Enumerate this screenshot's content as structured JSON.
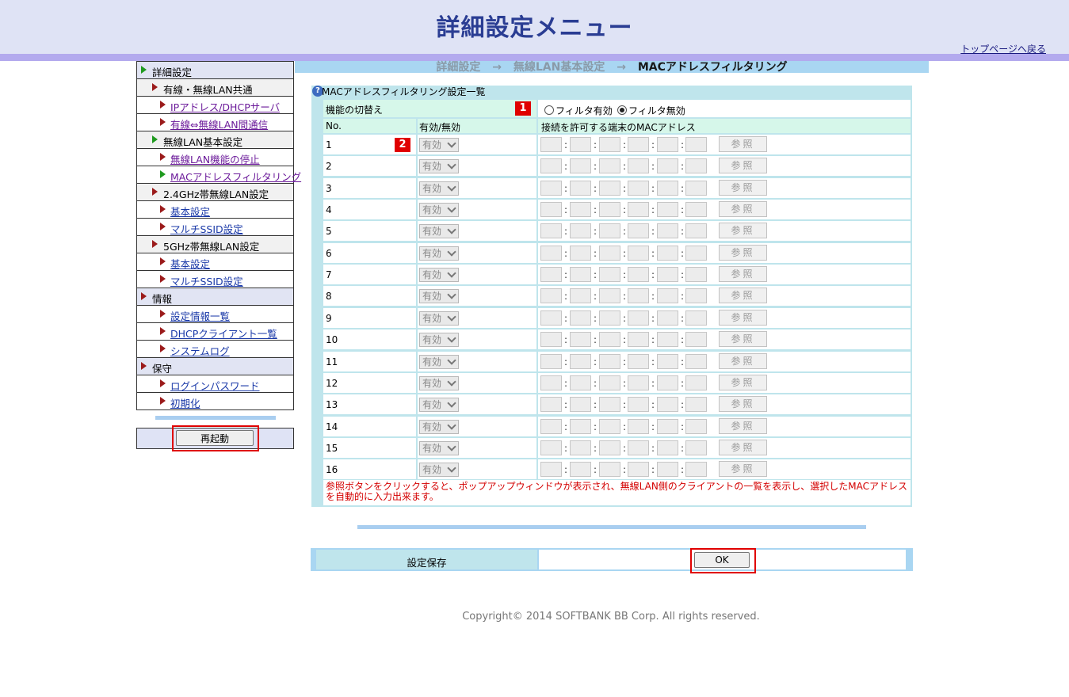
{
  "header": {
    "title": "詳細設定メニュー",
    "top_link": "トップページへ戻る"
  },
  "breadcrumb": {
    "items": [
      "詳細設定",
      "無線LAN基本設定",
      "MACアドレスフィルタリング"
    ],
    "separator": "→"
  },
  "sidebar": {
    "items": [
      {
        "label": "詳細設定",
        "kind": "section",
        "icon": "green-triangle-icon"
      },
      {
        "label": "有線・無線LAN共通",
        "kind": "sub",
        "icon": "red-triangle-icon"
      },
      {
        "label": "IPアドレス/DHCPサーバ",
        "kind": "link",
        "icon": "red-triangle-icon"
      },
      {
        "label": "有線⇔無線LAN間通信",
        "kind": "link",
        "icon": "red-triangle-icon"
      },
      {
        "label": "無線LAN基本設定",
        "kind": "sub",
        "icon": "green-triangle-icon"
      },
      {
        "label": "無線LAN機能の停止",
        "kind": "link",
        "icon": "red-triangle-icon"
      },
      {
        "label": "MACアドレスフィルタリング",
        "kind": "link",
        "icon": "green-triangle-icon"
      },
      {
        "label": "2.4GHz帯無線LAN設定",
        "kind": "sub",
        "icon": "red-triangle-icon"
      },
      {
        "label": "基本設定",
        "kind": "link-blue",
        "icon": "red-triangle-icon"
      },
      {
        "label": "マルチSSID設定",
        "kind": "link-blue",
        "icon": "red-triangle-icon"
      },
      {
        "label": "5GHz帯無線LAN設定",
        "kind": "sub",
        "icon": "red-triangle-icon"
      },
      {
        "label": "基本設定",
        "kind": "link-blue",
        "icon": "red-triangle-icon"
      },
      {
        "label": "マルチSSID設定",
        "kind": "link-blue",
        "icon": "red-triangle-icon"
      },
      {
        "label": "情報",
        "kind": "section",
        "icon": "red-triangle-icon"
      },
      {
        "label": "設定情報一覧",
        "kind": "link-blue",
        "icon": "red-triangle-icon"
      },
      {
        "label": "DHCPクライアント一覧",
        "kind": "link-blue",
        "icon": "red-triangle-icon"
      },
      {
        "label": "システムログ",
        "kind": "link-blue",
        "icon": "red-triangle-icon"
      },
      {
        "label": "保守",
        "kind": "section",
        "icon": "red-triangle-icon"
      },
      {
        "label": "ログインパスワード",
        "kind": "link-blue",
        "icon": "red-triangle-icon"
      },
      {
        "label": "初期化",
        "kind": "link-blue",
        "icon": "red-triangle-icon"
      }
    ],
    "restart_label": "再起動"
  },
  "main": {
    "help_icon": "?",
    "panel_title": "MACアドレスフィルタリング設定一覧",
    "toggle_label": "機能の切替え",
    "badge1": "1",
    "badge2": "2",
    "filter_on": "フィルタ有効",
    "filter_off": "フィルタ無効",
    "filter_selected": "フィルタ無効",
    "col_no": "No.",
    "col_enable": "有効/無効",
    "col_mac": "接続を許可する端末のMACアドレス",
    "select_value": "有効",
    "ref_label": "参照",
    "rows": [
      "1",
      "2",
      "3",
      "4",
      "5",
      "6",
      "7",
      "8",
      "9",
      "10",
      "11",
      "12",
      "13",
      "14",
      "15",
      "16"
    ],
    "note": "参照ボタンをクリックすると、ポップアップウィンドウが表示され、無線LAN側のクライアントの一覧を表示し、選択したMACアドレスを自動的に入力出来ます。"
  },
  "save": {
    "label": "設定保存",
    "ok_label": "OK"
  },
  "footer": {
    "copyright": "Copyright© 2014 SOFTBANK BB Corp. All rights reserved."
  },
  "colors": {
    "header_bg": "#dfe3f5",
    "title": "#2a3d93",
    "panel": "#bfe5ec",
    "accent_red": "#e00000"
  }
}
